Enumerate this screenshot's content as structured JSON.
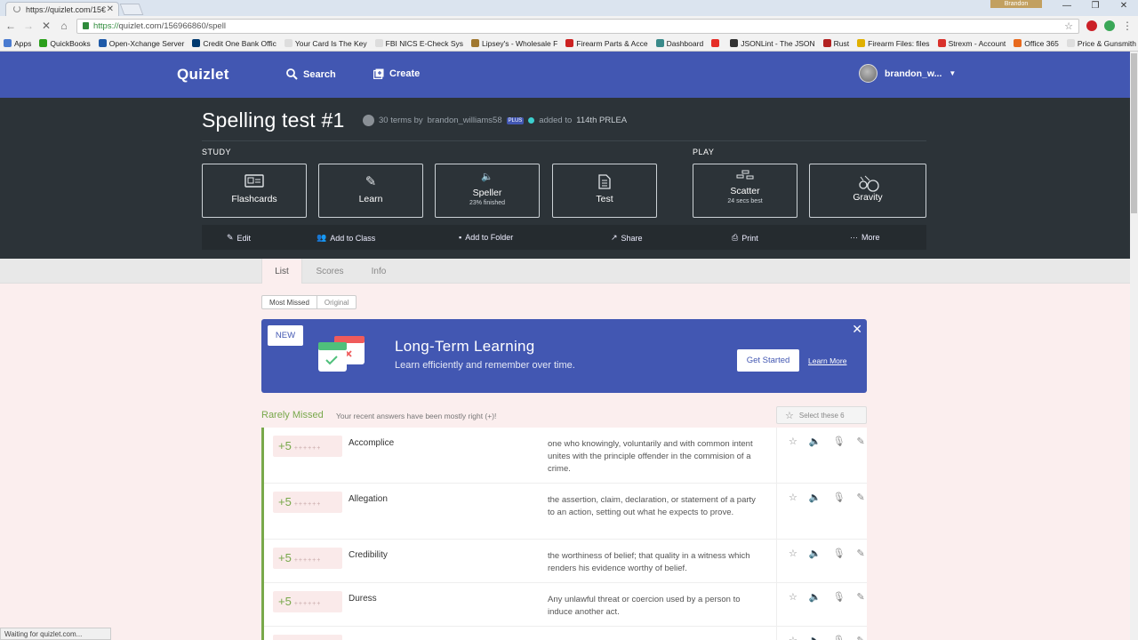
{
  "browser": {
    "tab_title": "https://quizlet.com/15€",
    "url_prefix": "https://",
    "url_rest": "quizlet.com/156966860/spell",
    "user_badge": "Brandon",
    "status_text": "Waiting for quizlet.com..."
  },
  "bookmarks": [
    {
      "label": "Apps",
      "color": "#4a7bd0"
    },
    {
      "label": "QuickBooks",
      "color": "#2ca01c"
    },
    {
      "label": "Open-Xchange Server",
      "color": "#1e5aa8"
    },
    {
      "label": "Credit One Bank Offic",
      "color": "#003a70"
    },
    {
      "label": "Your Card Is The Key",
      "color": "#dddddd"
    },
    {
      "label": "FBI NICS E-Check Sys",
      "color": "#dddddd"
    },
    {
      "label": "Lipsey's - Wholesale F",
      "color": "#a07830"
    },
    {
      "label": "Firearm Parts & Acce",
      "color": "#cc2222"
    },
    {
      "label": "Dashboard",
      "color": "#3a8a8a"
    },
    {
      "label": "",
      "color": "#e52d27"
    },
    {
      "label": "JSONLint - The JSON",
      "color": "#333333"
    },
    {
      "label": "Rust",
      "color": "#b22222"
    },
    {
      "label": "Firearm Files: files",
      "color": "#e0b000"
    },
    {
      "label": "Strexm - Account",
      "color": "#d9312b"
    },
    {
      "label": "Office 365",
      "color": "#e86a1e"
    },
    {
      "label": "Price & Gunsmith Ta",
      "color": "#dddddd"
    }
  ],
  "header": {
    "logo": "Quizlet",
    "search": "Search",
    "create": "Create",
    "username": "brandon_w..."
  },
  "set": {
    "title": "Spelling test #1",
    "terms": "30 terms by",
    "author": "brandon_williams58",
    "plus": "PLUS",
    "added": "added to",
    "class": "114th PRLEA",
    "study_label": "STUDY",
    "play_label": "PLAY",
    "modes": {
      "flashcards": "Flashcards",
      "learn": "Learn",
      "speller": "Speller",
      "speller_sub": "23% finished",
      "test": "Test",
      "scatter": "Scatter",
      "scatter_sub": "24 secs best",
      "gravity": "Gravity"
    },
    "actions": {
      "edit": "Edit",
      "add_class": "Add to Class",
      "add_folder": "Add to Folder",
      "share": "Share",
      "print": "Print",
      "more": "More"
    }
  },
  "tabs": {
    "list": "List",
    "scores": "Scores",
    "info": "Info"
  },
  "filter": {
    "most_missed": "Most Missed",
    "original": "Original"
  },
  "banner": {
    "badge": "NEW",
    "title": "Long-Term Learning",
    "subtitle": "Learn efficiently and remember over time.",
    "button": "Get Started",
    "link": "Learn More"
  },
  "list": {
    "group_label": "Rarely Missed",
    "group_note": "Your recent answers have been mostly right (+)!",
    "select_label": "Select these 6",
    "terms": [
      {
        "score": "+5",
        "ticks": "++++++",
        "term": "Accomplice",
        "definition": "one who knowingly, voluntarily and with common intent unites with the principle offender in the commision of a crime."
      },
      {
        "score": "+5",
        "ticks": "++++++",
        "term": "Allegation",
        "definition": "the assertion, claim, declaration, or statement of a party to an action, setting out what he expects to prove."
      },
      {
        "score": "+5",
        "ticks": "++++++",
        "term": "Credibility",
        "definition": "the worthiness of belief; that quality in a witness which renders his evidence worthy of belief."
      },
      {
        "score": "+5",
        "ticks": "++++++",
        "term": "Duress",
        "definition": "Any unlawful threat or coercion used by a person to induce another act."
      },
      {
        "score": "+5",
        "ticks": "++++++",
        "term": "",
        "definition": ""
      }
    ]
  }
}
